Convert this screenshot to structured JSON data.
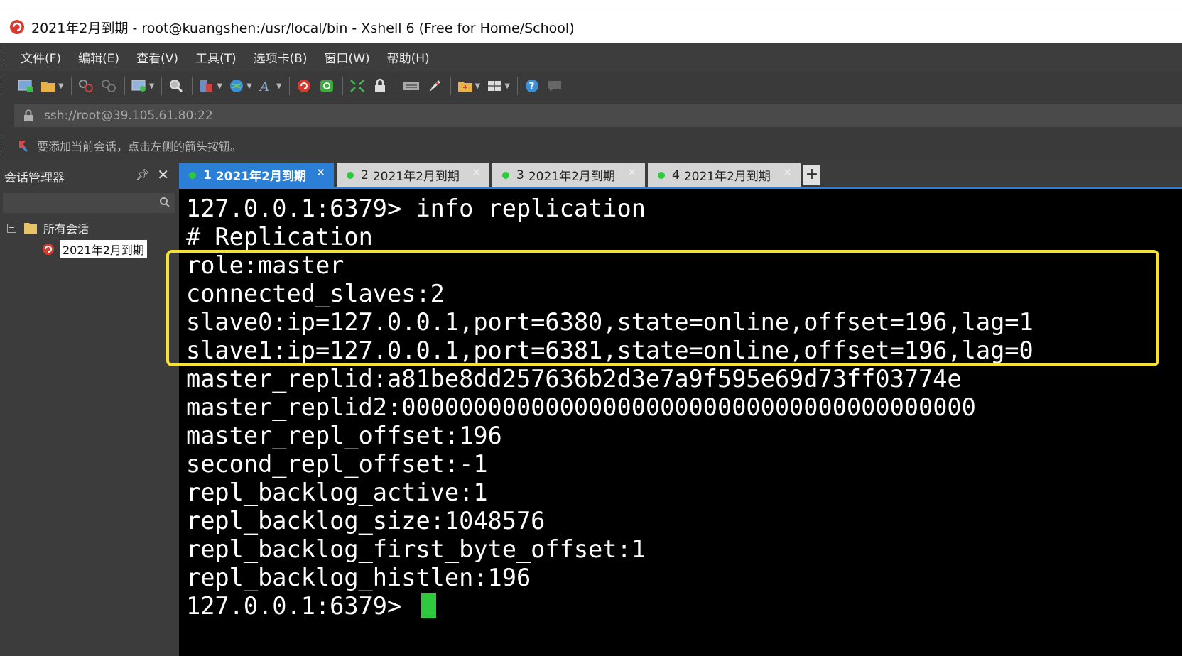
{
  "window": {
    "title": "2021年2月到期 - root@kuangshen:/usr/local/bin - Xshell 6 (Free for Home/School)"
  },
  "menu": [
    "文件(F)",
    "编辑(E)",
    "查看(V)",
    "工具(T)",
    "选项卡(B)",
    "窗口(W)",
    "帮助(H)"
  ],
  "address": "ssh://root@39.105.61.80:22",
  "hint": "要添加当前会话，点击左侧的箭头按钮。",
  "sidebar": {
    "title": "会话管理器",
    "tree_root": "所有会话",
    "tree_item": "2021年2月到期",
    "collapse_glyph": "−"
  },
  "tabs": [
    {
      "num": "1",
      "label": "2021年2月到期"
    },
    {
      "num": "2",
      "label": "2021年2月到期"
    },
    {
      "num": "3",
      "label": "2021年2月到期"
    },
    {
      "num": "4",
      "label": "2021年2月到期"
    }
  ],
  "terminal": {
    "lines": [
      "127.0.0.1:6379> info replication",
      "# Replication",
      "role:master",
      "connected_slaves:2",
      "slave0:ip=127.0.0.1,port=6380,state=online,offset=196,lag=1",
      "slave1:ip=127.0.0.1,port=6381,state=online,offset=196,lag=0",
      "master_replid:a81be8dd257636b2d3e7a9f595e69d73ff03774e",
      "master_replid2:0000000000000000000000000000000000000000",
      "master_repl_offset:196",
      "second_repl_offset:-1",
      "repl_backlog_active:1",
      "repl_backlog_size:1048576",
      "repl_backlog_first_byte_offset:1",
      "repl_backlog_histlen:196"
    ],
    "prompt": "127.0.0.1:6379> "
  },
  "colors": {
    "terminal_bg": "#000000",
    "terminal_fg": "#ffffff",
    "cursor": "#2ec93c",
    "highlight_border": "#f5e033",
    "active_tab": "#2b7fd6",
    "status_dot": "#2ec93c"
  },
  "icons": [
    "new-session-icon",
    "open-folder-icon",
    "connect-icon",
    "disconnect-icon",
    "reconnect-icon",
    "find-icon",
    "transfer-icon",
    "globe-icon",
    "font-icon",
    "xshell-icon",
    "xftp-icon",
    "fullscreen-icon",
    "lock-icon",
    "keyboard-icon",
    "highlighter-icon",
    "new-folder-icon",
    "layout-icon",
    "help-icon",
    "chat-icon"
  ]
}
